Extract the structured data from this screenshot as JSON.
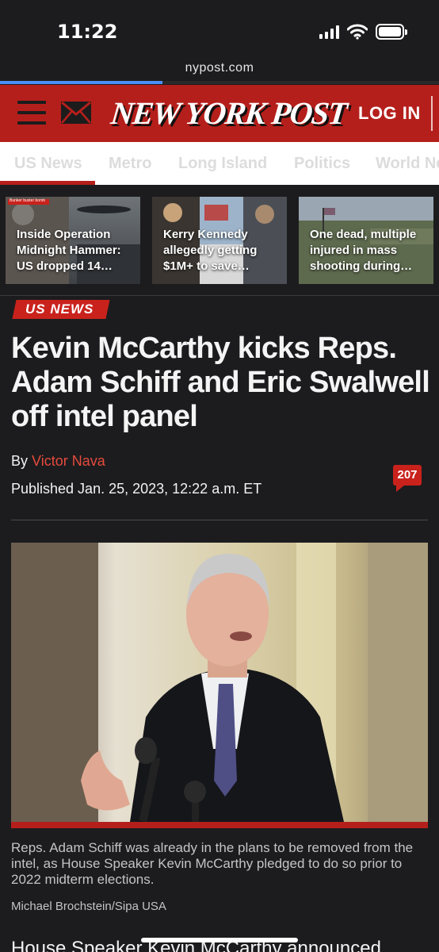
{
  "status_bar": {
    "time": "11:22"
  },
  "browser": {
    "url": "nypost.com",
    "load_progress": 0.37
  },
  "masthead": {
    "logo_text": "NEW YORK POST",
    "login_label": "LOG IN"
  },
  "nav": {
    "tabs": [
      {
        "label": "US News"
      },
      {
        "label": "Metro"
      },
      {
        "label": "Long Island"
      },
      {
        "label": "Politics"
      },
      {
        "label": "World Ne"
      }
    ],
    "active_index": 0
  },
  "story_cards": [
    {
      "title": "Inside Operation Midnight Hammer: US dropped 14…",
      "image_tag": "Bunker buster bomb"
    },
    {
      "title": "Kerry Kennedy allegedly getting $1M+ to save…"
    },
    {
      "title": "One dead, multiple injured in mass shooting during…"
    }
  ],
  "article": {
    "section": "US NEWS",
    "headline": "Kevin McCarthy kicks Reps. Adam Schiff and Eric Swalwell off intel panel",
    "byline_prefix": "By",
    "author": "Victor Nava",
    "published": "Published Jan. 25, 2023, 12:22 a.m. ET",
    "comment_count": "207",
    "photo_caption": "Reps. Adam Schiff was already in the plans to be removed from the intel, as House Speaker Kevin McCarthy pledged to do so prior to 2022 midterm elections.",
    "photo_credit": "Michael Brochstein/Sipa USA",
    "body_lead": "House Speaker Kevin McCarthy announced"
  },
  "colors": {
    "brand_red": "#b51f1b",
    "badge_red": "#c9221c",
    "author_link": "#e64a3d",
    "background": "#1c1c1e",
    "progress_blue": "#4c8ef7"
  },
  "icons": {
    "menu": "hamburger-icon",
    "mail": "envelope-icon",
    "signal": "cellular-signal-icon",
    "wifi": "wifi-icon",
    "battery": "battery-icon",
    "comments": "comment-bubble-icon"
  }
}
